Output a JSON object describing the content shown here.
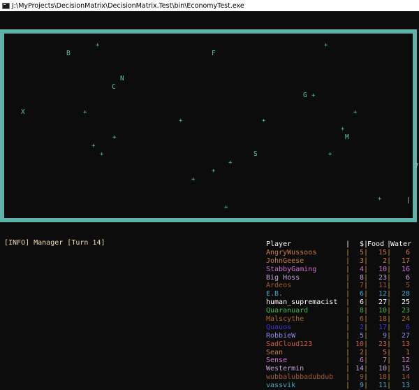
{
  "window": {
    "title": "J:\\MyProjects\\DecisionMatrix\\DecisionMatrix.Test\\bin\\EconomyTest.exe"
  },
  "map": {
    "border_color": "#5fb3a8",
    "marker_color": "#58c4a4",
    "marker_glyph": "+",
    "labels": [
      "B",
      "F",
      "N",
      "C",
      "G",
      "X",
      "M",
      "S"
    ],
    "edge_marks": [
      "7",
      "|"
    ]
  },
  "log": {
    "line": "[INFO] Manager [Turn 14]"
  },
  "players_table": {
    "headers": {
      "player": "Player",
      "sep": "|",
      "money": "$",
      "food": "Food",
      "water": "Water"
    },
    "rows": [
      {
        "name": "AngryWussoos",
        "money": "5",
        "food": "15",
        "water": "6",
        "color": "#c87a4a"
      },
      {
        "name": "JohnGeese",
        "money": "3",
        "food": "2",
        "water": "17",
        "color": "#c87a4a"
      },
      {
        "name": "StabbyGaming",
        "money": "4",
        "food": "10",
        "water": "16",
        "color": "#d070d0"
      },
      {
        "name": "Big Hoss",
        "money": "8",
        "food": "23",
        "water": "6",
        "color": "#c2a3d9"
      },
      {
        "name": "Ardeos",
        "money": "7",
        "food": "11",
        "water": "5",
        "color": "#a05a32"
      },
      {
        "name": "E.B.",
        "money": "6",
        "food": "12",
        "water": "28",
        "color": "#3fa6c8"
      },
      {
        "name": "human_supremacist",
        "money": "6",
        "food": "27",
        "water": "25",
        "color": "#ffffff"
      },
      {
        "name": "Quaranuard",
        "money": "8",
        "food": "10",
        "water": "23",
        "color": "#44b84c"
      },
      {
        "name": "Malscythe",
        "money": "6",
        "food": "18",
        "water": "24",
        "color": "#a86a2c"
      },
      {
        "name": "Quauos",
        "money": "2",
        "food": "17",
        "water": "6",
        "color": "#3a3ad0"
      },
      {
        "name": "RobbieW",
        "money": "5",
        "food": "9",
        "water": "27",
        "color": "#8a8ae8"
      },
      {
        "name": "SadCloud123",
        "money": "10",
        "food": "23",
        "water": "13",
        "color": "#d05a3a"
      },
      {
        "name": "Sean",
        "money": "2",
        "food": "5",
        "water": "1",
        "color": "#c87a4a"
      },
      {
        "name": "Sense",
        "money": "6",
        "food": "7",
        "water": "12",
        "color": "#d070d0"
      },
      {
        "name": "Westermin",
        "money": "14",
        "food": "10",
        "water": "15",
        "color": "#c2a3d9"
      },
      {
        "name": "wubbalubbadubdub",
        "money": "9",
        "food": "18",
        "water": "14",
        "color": "#a05a32"
      },
      {
        "name": "vassvik",
        "money": "9",
        "food": "11",
        "water": "13",
        "color": "#4aa8c0"
      }
    ]
  }
}
